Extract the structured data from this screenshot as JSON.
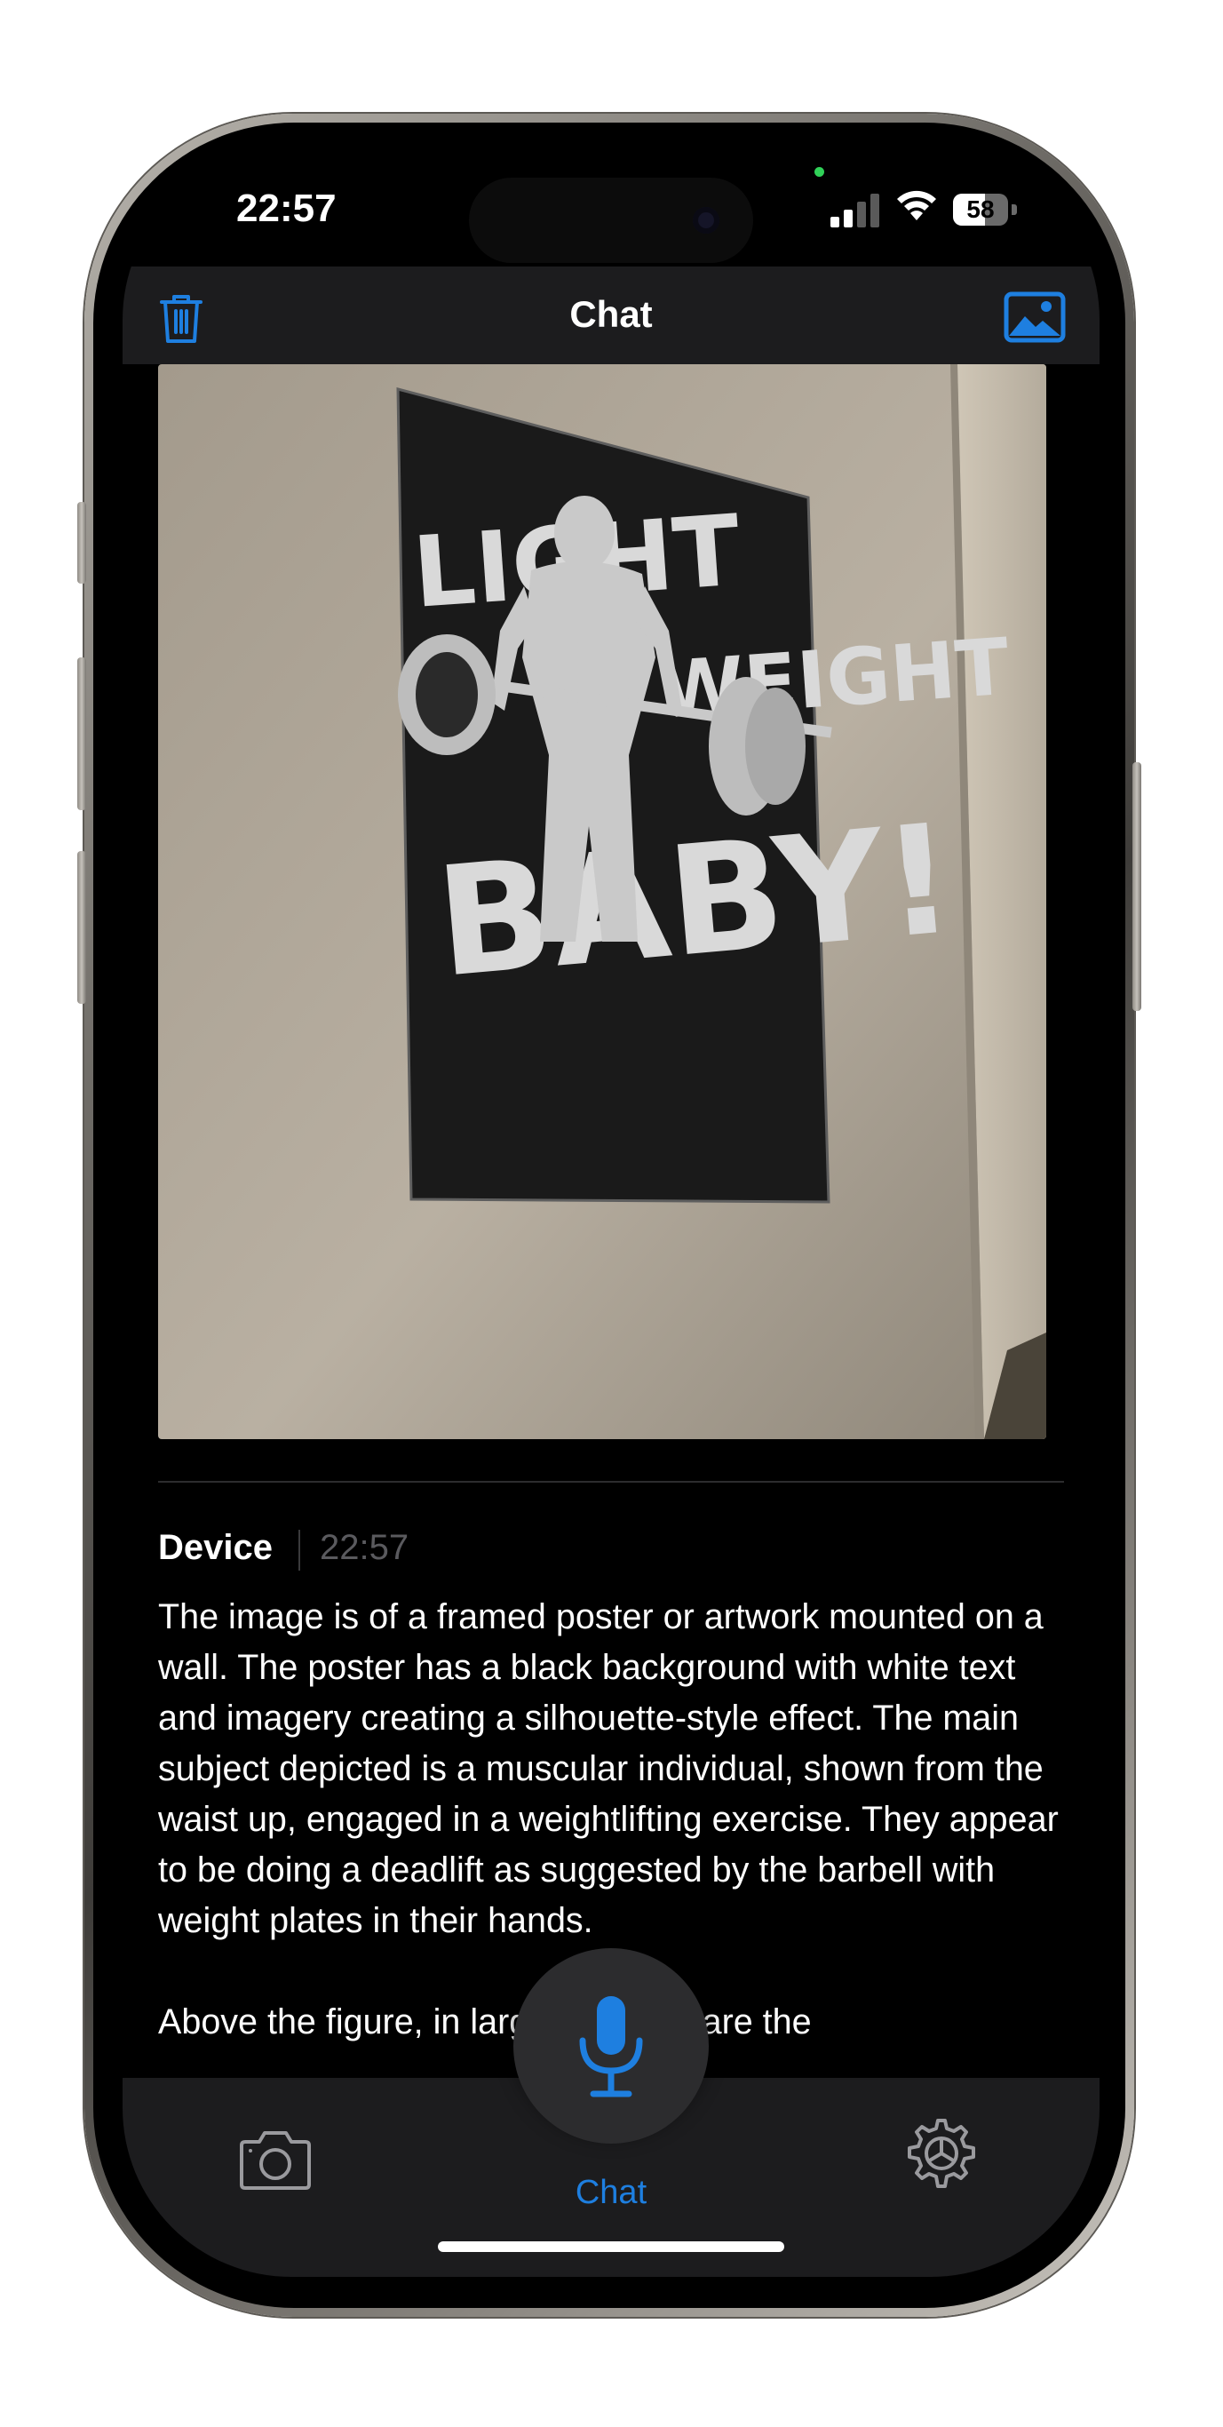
{
  "status_bar": {
    "time": "22:57",
    "battery": "58",
    "battery_level": 0.58,
    "icons": [
      "cellular-signal-icon",
      "wifi-icon",
      "battery-icon"
    ]
  },
  "nav": {
    "title": "Chat",
    "left_icon": "trash-icon",
    "right_icon": "photo-icon"
  },
  "photo": {
    "description_icon": "poster-photo",
    "poster_text_line1": "LIGHT",
    "poster_text_line1b": "WEIGHT",
    "poster_text_line2": "BABY!"
  },
  "message": {
    "sender": "Device",
    "time": "22:57",
    "text": "The image is of a framed poster or artwork mounted on a wall. The poster has a black background with white text and imagery creating a silhouette-style effect. The main subject depicted is a muscular individual, shown from the waist up, engaged in a weightlifting exercise. They appear to be doing a deadlift as suggested by the barbell with weight plates in their hands.\n\nAbove the figure, in large lettering, are the"
  },
  "tab_bar": {
    "camera_icon": "camera-icon",
    "mic_icon": "microphone-icon",
    "chat_label": "Chat",
    "settings_icon": "settings-gear-icon"
  },
  "colors": {
    "accent": "#1e7fe0",
    "bar_background": "#1c1c1e",
    "screen_background": "#000000"
  }
}
